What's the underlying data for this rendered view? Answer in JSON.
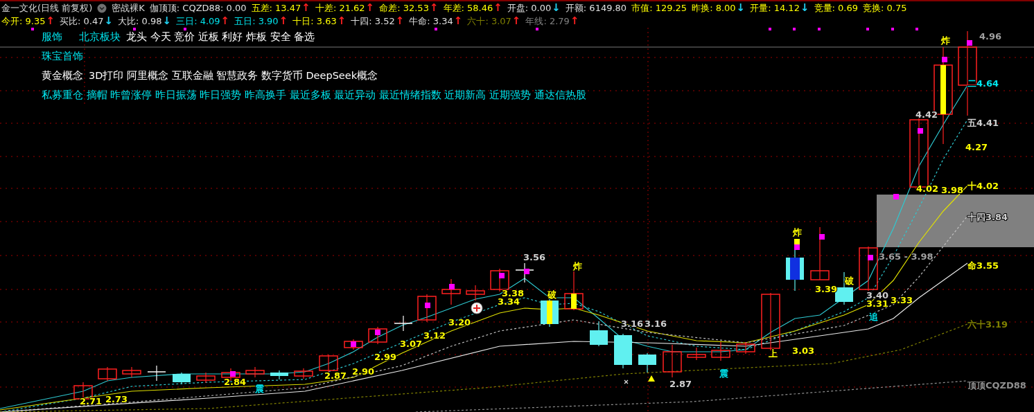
{
  "header": {
    "title": "金一文化(日线 前复权)",
    "indicator": "密战裸K",
    "row1": [
      {
        "text": "伽顶顶: CQZD88: 0.00",
        "color": "#e0e0e0"
      },
      {
        "text": "五差: 13.47",
        "color": "#ffff00",
        "arrow": {
          "text": "↑",
          "color": "#ff2020"
        }
      },
      {
        "text": "十差: 21.62",
        "color": "#ffff00",
        "arrow": {
          "text": "↑",
          "color": "#ff2020"
        }
      },
      {
        "text": "命差: 32.53",
        "color": "#ffff00",
        "arrow": {
          "text": "↑",
          "color": "#ff2020"
        }
      },
      {
        "text": "年差: 58.46",
        "color": "#ffff00",
        "arrow": {
          "text": "↑",
          "color": "#ff2020"
        }
      },
      {
        "text": "开盘: 0.00",
        "color": "#e0e0e0",
        "arrow": {
          "text": "↓",
          "color": "#20d0f0"
        }
      },
      {
        "text": "开额: 6149.80",
        "color": "#e0e0e0"
      },
      {
        "text": "市值: 129.25",
        "color": "#ffff00"
      },
      {
        "text": "昨换: 8.00",
        "color": "#ffff00",
        "arrow": {
          "text": "↓",
          "color": "#20d0f0"
        }
      },
      {
        "text": "开量: 14.12",
        "color": "#ffff00",
        "arrow": {
          "text": "↓",
          "color": "#20d0f0"
        }
      },
      {
        "text": "竞量: 0.69",
        "color": "#ffff00"
      },
      {
        "text": "竞换: 0.75",
        "color": "#ffff00"
      }
    ],
    "row2": [
      {
        "text": "今开: 9.35",
        "color": "#ffff00",
        "arrow": {
          "text": "↑",
          "color": "#ff2020"
        }
      },
      {
        "text": "买比: 0.47",
        "color": "#e0e0e0",
        "arrow": {
          "text": "↓",
          "color": "#20d0f0"
        }
      },
      {
        "text": "大比: 0.98",
        "color": "#e0e0e0",
        "arrow": {
          "text": "↓",
          "color": "#20d0f0"
        }
      },
      {
        "text": "三日: 4.09",
        "color": "#00e5ee",
        "arrow": {
          "text": "↑",
          "color": "#ff2020"
        }
      },
      {
        "text": "五日: 3.90",
        "color": "#00e5ee",
        "arrow": {
          "text": "↑",
          "color": "#ff2020"
        }
      },
      {
        "text": "十日: 3.63",
        "color": "#ffff00",
        "arrow": {
          "text": "↑",
          "color": "#ff2020"
        }
      },
      {
        "text": "十四: 3.52",
        "color": "#e0e0e0",
        "arrow": {
          "text": "↑",
          "color": "#ff2020"
        }
      },
      {
        "text": "牛命: 3.34",
        "color": "#e0e0e0",
        "arrow": {
          "text": "↑",
          "color": "#ff2020"
        }
      },
      {
        "text": "六十: 3.07",
        "color": "#808000",
        "arrow": {
          "text": "↑",
          "color": "#ff2020"
        }
      },
      {
        "text": "年线: 2.79",
        "color": "#808080",
        "arrow": {
          "text": "↑",
          "color": "#ff2020"
        }
      }
    ]
  },
  "concepts": [
    {
      "items": [
        {
          "text": "服饰",
          "color": "#00e5ee"
        },
        {
          "text": "北京板块",
          "color": "#00e5ee"
        },
        {
          "text": "龙头 今天 竞价 近板 利好 炸板 安全 备选",
          "color": "#ffffff"
        }
      ]
    },
    {
      "items": [
        {
          "text": "珠宝首饰",
          "color": "#00e5ee"
        }
      ]
    },
    {
      "items": [
        {
          "text": "黄金概念",
          "color": "#ffffff"
        },
        {
          "text": "3D打印 阿里概念 互联金融 智慧政务 数字货币 DeepSeek概念",
          "color": "#ffffff"
        }
      ]
    },
    {
      "items": [
        {
          "text": "私募重仓 摘帽 昨曾涨停 昨日振荡 昨日强势 昨高换手 最近多板 最近异动 最近情绪指数 近期新高 近期强势 通达信热股",
          "color": "#00e5ee"
        }
      ]
    }
  ],
  "chart": {
    "labels": [
      {
        "text": "3.56",
        "color": "#d0d0d0"
      },
      {
        "text": "炸",
        "color": "#ffff00"
      },
      {
        "text": "3.38",
        "color": "#ffff00"
      },
      {
        "text": "3.34",
        "color": "#ffff00"
      },
      {
        "text": "破",
        "color": "#ffff00"
      },
      {
        "text": "3.20",
        "color": "#ffff00"
      },
      {
        "text": "3.12",
        "color": "#ffff00"
      },
      {
        "text": "3.07",
        "color": "#ffff00"
      },
      {
        "text": "2.99",
        "color": "#ffff00"
      },
      {
        "text": "2.87",
        "color": "#ffff00"
      },
      {
        "text": "2.90",
        "color": "#ffff00"
      },
      {
        "text": "2.84",
        "color": "#ffff00"
      },
      {
        "text": "震",
        "color": "#00e5ee"
      },
      {
        "text": "2.71",
        "color": "#ffff00"
      },
      {
        "text": "2.73",
        "color": "#ffff00"
      },
      {
        "text": "3.16",
        "color": "#d0d0d0"
      },
      {
        "text": "3.16",
        "color": "#d0d0d0"
      },
      {
        "text": "2.87",
        "color": "#d0d0d0"
      },
      {
        "text": "震",
        "color": "#00e5ee"
      },
      {
        "text": "上",
        "color": "#ffff00"
      },
      {
        "text": "3.03",
        "color": "#ffff00"
      },
      {
        "text": "炸",
        "color": "#ffff00"
      },
      {
        "text": "3.39",
        "color": "#ffff00"
      },
      {
        "text": "破",
        "color": "#ffff00"
      },
      {
        "text": "3.40",
        "color": "#d0d0d0"
      },
      {
        "text": "3.31",
        "color": "#ffff00"
      },
      {
        "text": "3.33",
        "color": "#ffff00"
      },
      {
        "text": "追",
        "color": "#00e5ee"
      },
      {
        "text": "3.65 - 3.98",
        "color": "#a0a0a0"
      },
      {
        "text": "4.42",
        "color": "#d0d0d0"
      },
      {
        "text": "炸",
        "color": "#ffff00"
      },
      {
        "text": "4.96",
        "color": "#a0a0a0"
      },
      {
        "text": "二4.64",
        "color": "#00e5ee"
      },
      {
        "text": "五4.41",
        "color": "#d0d0d0"
      },
      {
        "text": "4.27",
        "color": "#ffff00"
      },
      {
        "text": "4.02",
        "color": "#ffff00"
      },
      {
        "text": "3.98",
        "color": "#ffff00"
      },
      {
        "text": "十4.02",
        "color": "#ffff00"
      },
      {
        "text": "十四3.84",
        "color": "#d0d0d0"
      },
      {
        "text": "命3.55",
        "color": "#ffff00"
      },
      {
        "text": "六十3.19",
        "color": "#808000"
      },
      {
        "text": "顶顶CQZD88",
        "color": "#909090"
      }
    ]
  }
}
